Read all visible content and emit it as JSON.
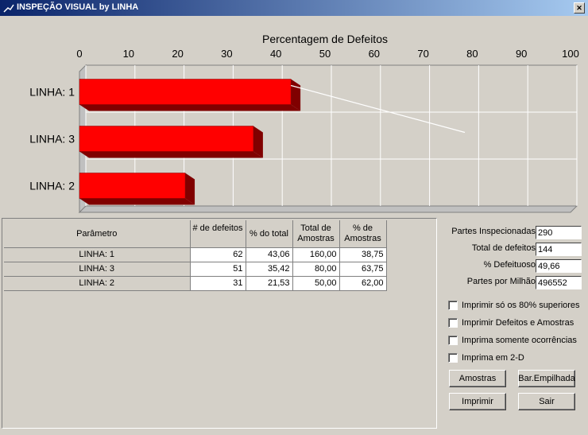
{
  "window": {
    "title": "INSPEÇÃO VISUAL by LINHA",
    "close_glyph": "✕"
  },
  "chart_data": {
    "type": "bar",
    "orientation": "horizontal",
    "title": "Percentagem de Defeitos",
    "categories": [
      "LINHA: 1",
      "LINHA: 3",
      "LINHA: 2"
    ],
    "values": [
      43.06,
      35.42,
      21.53
    ],
    "pareto_line": [
      43.06,
      78.48
    ],
    "xlim": [
      0,
      100
    ],
    "xticks": [
      0,
      10,
      20,
      30,
      40,
      50,
      60,
      70,
      80,
      90,
      100
    ],
    "grid": true,
    "bar_color": "#ff0000",
    "bar_shadow_color": "#800000"
  },
  "table": {
    "headers": [
      "Parâmetro",
      "# de defeitos",
      "% do total",
      "Total de Amostras",
      "% de Amostras"
    ],
    "rows": [
      {
        "name": "LINHA: 1",
        "defeitos": "62",
        "total": "43,06",
        "amostras": "160,00",
        "pct_amostras": "38,75"
      },
      {
        "name": "LINHA: 3",
        "defeitos": "51",
        "total": "35,42",
        "amostras": "80,00",
        "pct_amostras": "63,75"
      },
      {
        "name": "LINHA: 2",
        "defeitos": "31",
        "total": "21,53",
        "amostras": "50,00",
        "pct_amostras": "62,00"
      }
    ]
  },
  "summary": {
    "partes_inspecionadas_label": "Partes Inspecionadas",
    "partes_inspecionadas": "290",
    "total_defeitos_label": "Total de defeitos",
    "total_defeitos": "144",
    "pct_defeituoso_label": "% Defeituoso",
    "pct_defeituoso": "49,66",
    "partes_milhao_label": "Partes por Milhão",
    "partes_milhao": "496552"
  },
  "options": [
    {
      "label": "Imprimir só os 80% superiores",
      "checked": false
    },
    {
      "label": "Imprimir Defeitos e Amostras",
      "checked": false
    },
    {
      "label": "Imprima somente ocorrências",
      "checked": false
    },
    {
      "label": "Imprima em 2-D",
      "checked": false
    }
  ],
  "buttons": {
    "amostras": "Amostras",
    "bar_empilhada": "Bar.Empilhada",
    "imprimir": "Imprimir",
    "sair": "Sair"
  }
}
